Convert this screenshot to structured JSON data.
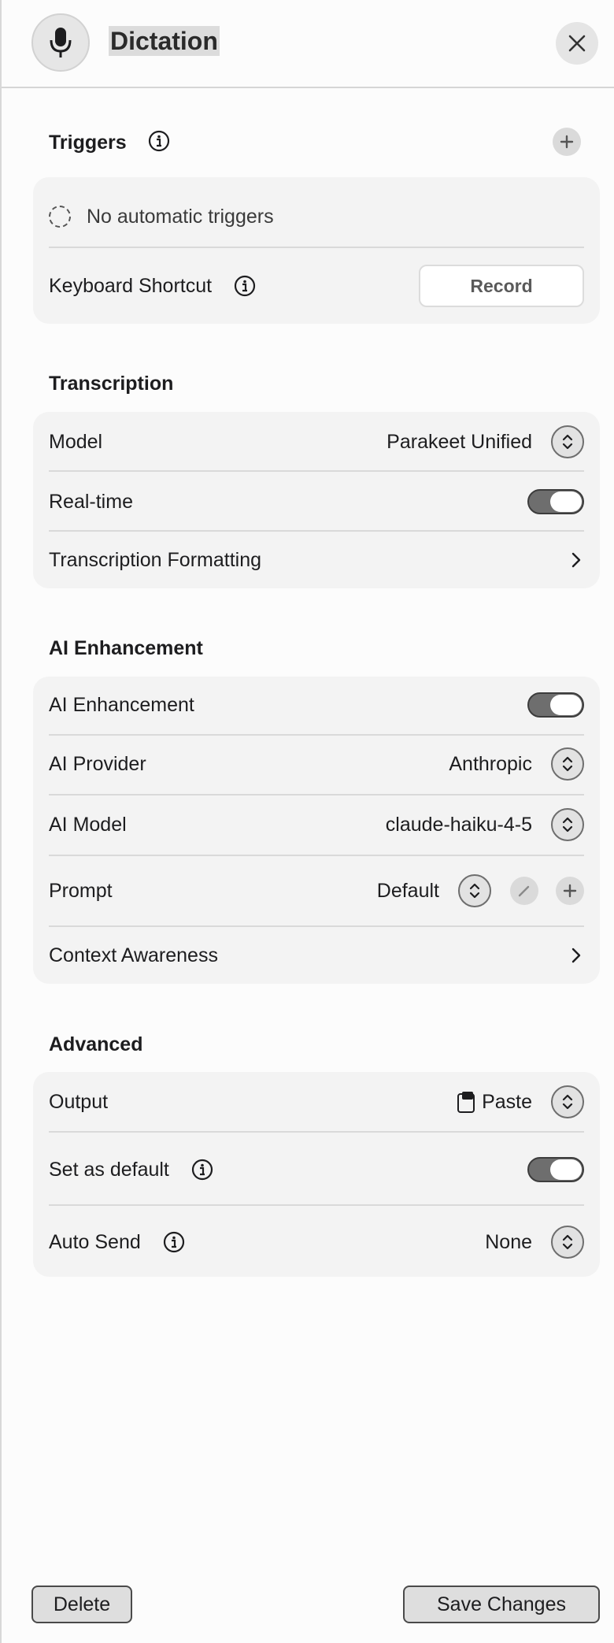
{
  "window": {
    "title": "Dictation"
  },
  "triggers": {
    "title": "Triggers",
    "empty_text": "No automatic triggers",
    "keyboard_shortcut_label": "Keyboard Shortcut",
    "record_label": "Record"
  },
  "transcription": {
    "title": "Transcription",
    "model_label": "Model",
    "model_value": "Parakeet Unified",
    "realtime_label": "Real-time",
    "realtime_on": true,
    "formatting_label": "Transcription Formatting"
  },
  "ai": {
    "title": "AI Enhancement",
    "enhancement_label": "AI Enhancement",
    "enhancement_on": true,
    "provider_label": "AI Provider",
    "provider_value": "Anthropic",
    "model_label": "AI Model",
    "model_value": "claude-haiku-4-5",
    "prompt_label": "Prompt",
    "prompt_value": "Default",
    "context_label": "Context Awareness"
  },
  "advanced": {
    "title": "Advanced",
    "output_label": "Output",
    "output_value": "Paste",
    "default_label": "Set as default",
    "default_on": true,
    "autosend_label": "Auto Send",
    "autosend_value": "None"
  },
  "footer": {
    "delete_label": "Delete",
    "save_label": "Save Changes"
  },
  "icons": {
    "header": "microphone-icon",
    "close": "close-icon",
    "info": "info-icon",
    "add": "plus-icon",
    "edit": "pencil-icon",
    "chevron": "chevron-right-icon",
    "stepper": "up-down-chevron-icon",
    "clipboard": "clipboard-icon"
  }
}
